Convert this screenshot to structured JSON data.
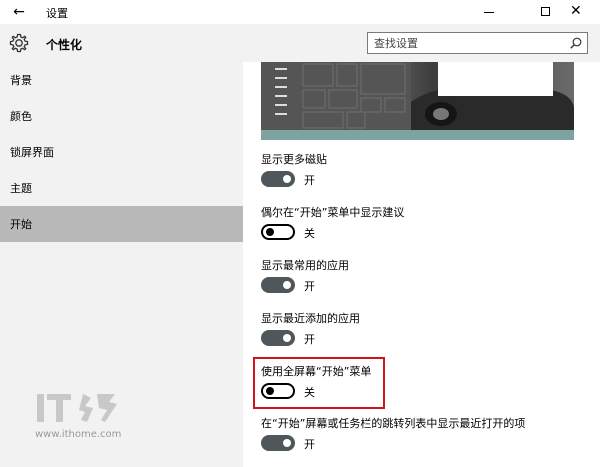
{
  "window": {
    "title": "设置",
    "back_glyph": "←",
    "close_glyph": "✕"
  },
  "header": {
    "page_title": "个性化",
    "search_placeholder": "查找设置"
  },
  "sidebar": {
    "items": [
      {
        "label": "背景"
      },
      {
        "label": "颜色"
      },
      {
        "label": "锁屏界面"
      },
      {
        "label": "主题"
      },
      {
        "label": "开始",
        "selected": true
      }
    ]
  },
  "settings": [
    {
      "label": "显示更多磁贴",
      "state": "on",
      "state_label": "开"
    },
    {
      "label": "偶尔在“开始”菜单中显示建议",
      "state": "off",
      "state_label": "关"
    },
    {
      "label": "显示最常用的应用",
      "state": "on",
      "state_label": "开"
    },
    {
      "label": "显示最近添加的应用",
      "state": "on",
      "state_label": "开"
    },
    {
      "label": "使用全屏幕“开始”菜单",
      "state": "off",
      "state_label": "关",
      "highlighted": true
    },
    {
      "label": "在“开始”屏幕或任务栏的跳转列表中显示最近打开的项",
      "state": "on",
      "state_label": "开"
    }
  ],
  "watermark": {
    "url": "www.ithome.com"
  },
  "colors": {
    "toggle_on": "#4f575a",
    "sidebar_bg": "#f2f2f2",
    "sidebar_selected": "#b9b9b9",
    "highlight_border": "#d0121b"
  }
}
